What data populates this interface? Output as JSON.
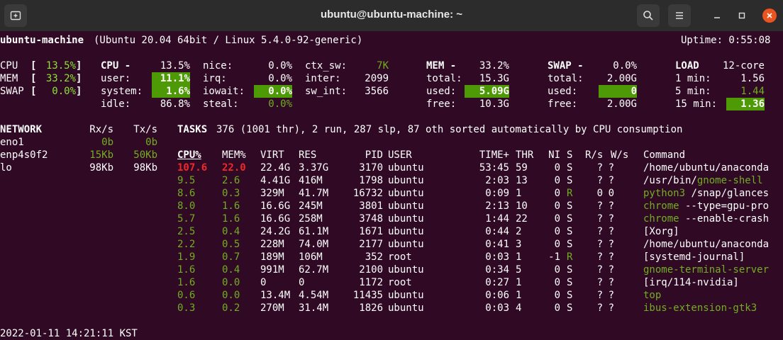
{
  "window": {
    "title": "ubuntu@ubuntu-machine: ~",
    "icons": [
      "new-tab-icon",
      "search-icon",
      "hamburger-menu-icon",
      "minimize-icon",
      "maximize-icon",
      "close-icon"
    ]
  },
  "header": {
    "host": "ubuntu-machine",
    "system": "(Ubuntu 20.04 64bit / Linux 5.4.0-92-generic)",
    "uptime": "Uptime: 0:55:08"
  },
  "quicklook": {
    "cpu_label": "CPU",
    "cpu_value": "13.5%",
    "mem_label": "MEM",
    "mem_value": "33.2%",
    "swap_label": "SWAP",
    "swap_value": "0.0%"
  },
  "cpu": {
    "title": "CPU -",
    "total": "13.5%",
    "user_label": "user:",
    "user": "11.1%",
    "system_label": "system:",
    "system": "1.6%",
    "idle_label": "idle:",
    "idle": "86.8%",
    "nice_label": "nice:",
    "nice": "0.0%",
    "irq_label": "irq:",
    "irq": "0.0%",
    "iowait_label": "iowait:",
    "iowait": "0.0%",
    "steal_label": "steal:",
    "steal": "0.0%",
    "ctx_sw_label": "ctx_sw:",
    "ctx_sw": "7K",
    "inter_label": "inter:",
    "inter": "2099",
    "sw_int_label": "sw_int:",
    "sw_int": "3566"
  },
  "mem": {
    "title": "MEM -",
    "percent": "33.2%",
    "total_label": "total:",
    "total": "15.3G",
    "used_label": "used:",
    "used": "5.09G",
    "free_label": "free:",
    "free": "10.3G"
  },
  "swap": {
    "title": "SWAP -",
    "percent": "0.0%",
    "total_label": "total:",
    "total": "2.00G",
    "used_label": "used:",
    "used": "0",
    "free_label": "free:",
    "free": "2.00G"
  },
  "load": {
    "title": "LOAD",
    "cores": "12-core",
    "m1_label": "1 min:",
    "m1": "1.56",
    "m5_label": "5 min:",
    "m5": "1.44",
    "m15_label": "15 min:",
    "m15": "1.36"
  },
  "network": {
    "title": "NETWORK",
    "rx_header": "Rx/s",
    "tx_header": "Tx/s",
    "interfaces": [
      {
        "name": "eno1",
        "rx": "0b",
        "tx": "0b"
      },
      {
        "name": "enp4s0f2",
        "rx": "15Kb",
        "tx": "50Kb"
      },
      {
        "name": "lo",
        "rx": "98Kb",
        "tx": "98Kb"
      }
    ]
  },
  "tasks": {
    "label": "TASKS",
    "summary": "376 (1001 thr), 2 run, 287 slp, 87 oth sorted automatically by CPU consumption"
  },
  "process_columns": [
    "CPU%",
    "MEM%",
    "VIRT",
    "RES",
    "PID",
    "USER",
    "TIME+",
    "THR",
    "NI",
    "S",
    "R/s",
    "W/s",
    "Command"
  ],
  "processes": [
    {
      "cpu": "107.6",
      "mem": "22.0",
      "virt": "22.4G",
      "res": "3.37G",
      "pid": "3170",
      "user": "ubuntu",
      "time": "53:45",
      "thr": "59",
      "ni": "0",
      "s": "S",
      "rs": "?",
      "ws": "?",
      "cmd_path": "/home/ubuntu/anaconda",
      "cmd_name": "",
      "cmd_args": ""
    },
    {
      "cpu": "9.5",
      "mem": "2.6",
      "virt": "4.41G",
      "res": "416M",
      "pid": "1798",
      "user": "ubuntu",
      "time": "2:03",
      "thr": "13",
      "ni": "0",
      "s": "S",
      "rs": "?",
      "ws": "?",
      "cmd_path": "/usr/bin/",
      "cmd_name": "gnome-shell",
      "cmd_args": ""
    },
    {
      "cpu": "8.6",
      "mem": "0.3",
      "virt": "329M",
      "res": "41.7M",
      "pid": "16732",
      "user": "ubuntu",
      "time": "0:09",
      "thr": "1",
      "ni": "0",
      "s": "R",
      "rs": "0",
      "ws": "0",
      "cmd_path": "",
      "cmd_name": "python3",
      "cmd_args": " /snap/glances"
    },
    {
      "cpu": "8.0",
      "mem": "1.6",
      "virt": "16.6G",
      "res": "245M",
      "pid": "3801",
      "user": "ubuntu",
      "time": "2:13",
      "thr": "10",
      "ni": "0",
      "s": "S",
      "rs": "?",
      "ws": "?",
      "cmd_path": "",
      "cmd_name": "chrome",
      "cmd_args": " --type=gpu-pro"
    },
    {
      "cpu": "5.7",
      "mem": "1.6",
      "virt": "16.6G",
      "res": "258M",
      "pid": "3748",
      "user": "ubuntu",
      "time": "1:44",
      "thr": "22",
      "ni": "0",
      "s": "S",
      "rs": "?",
      "ws": "?",
      "cmd_path": "",
      "cmd_name": "chrome",
      "cmd_args": " --enable-crash"
    },
    {
      "cpu": "2.5",
      "mem": "0.4",
      "virt": "24.2G",
      "res": "61.1M",
      "pid": "1671",
      "user": "ubuntu",
      "time": "0:44",
      "thr": "2",
      "ni": "0",
      "s": "S",
      "rs": "?",
      "ws": "?",
      "cmd_path": "[Xorg]",
      "cmd_name": "",
      "cmd_args": ""
    },
    {
      "cpu": "2.2",
      "mem": "0.5",
      "virt": "228M",
      "res": "74.0M",
      "pid": "2177",
      "user": "ubuntu",
      "time": "0:41",
      "thr": "3",
      "ni": "0",
      "s": "S",
      "rs": "?",
      "ws": "?",
      "cmd_path": "/home/ubuntu/anaconda",
      "cmd_name": "",
      "cmd_args": ""
    },
    {
      "cpu": "1.9",
      "mem": "0.7",
      "virt": "189M",
      "res": "106M",
      "pid": "352",
      "user": "root",
      "time": "0:03",
      "thr": "1",
      "ni": "-1",
      "s": "R",
      "rs": "?",
      "ws": "?",
      "cmd_path": "[systemd-journal]",
      "cmd_name": "",
      "cmd_args": ""
    },
    {
      "cpu": "1.6",
      "mem": "0.4",
      "virt": "991M",
      "res": "62.7M",
      "pid": "2100",
      "user": "ubuntu",
      "time": "0:34",
      "thr": "5",
      "ni": "0",
      "s": "S",
      "rs": "?",
      "ws": "?",
      "cmd_path": "",
      "cmd_name": "gnome-terminal-server",
      "cmd_args": ""
    },
    {
      "cpu": "1.6",
      "mem": "0.0",
      "virt": "0",
      "res": "0",
      "pid": "1172",
      "user": "root",
      "time": "0:27",
      "thr": "1",
      "ni": "0",
      "s": "S",
      "rs": "?",
      "ws": "?",
      "cmd_path": "[irq/114-nvidia]",
      "cmd_name": "",
      "cmd_args": ""
    },
    {
      "cpu": "0.6",
      "mem": "0.0",
      "virt": "13.4M",
      "res": "4.54M",
      "pid": "11435",
      "user": "ubuntu",
      "time": "0:06",
      "thr": "1",
      "ni": "0",
      "s": "S",
      "rs": "?",
      "ws": "?",
      "cmd_path": "",
      "cmd_name": "top",
      "cmd_args": ""
    },
    {
      "cpu": "0.3",
      "mem": "0.2",
      "virt": "270M",
      "res": "31.4M",
      "pid": "1826",
      "user": "ubuntu",
      "time": "0:03",
      "thr": "4",
      "ni": "0",
      "s": "S",
      "rs": "?",
      "ws": "?",
      "cmd_path": "",
      "cmd_name": "ibus-extension-gtk3",
      "cmd_args": ""
    }
  ],
  "footer": {
    "datetime": "2022-01-11 14:21:11 KST"
  },
  "colors": {
    "background": "#300a24",
    "titlebar": "#2c2c2c",
    "ok_green": "#8ae234",
    "dim_green": "#73ad21",
    "highlight_bg": "#4e9a06",
    "critical": "#ef2929",
    "close_button": "#e95420"
  }
}
